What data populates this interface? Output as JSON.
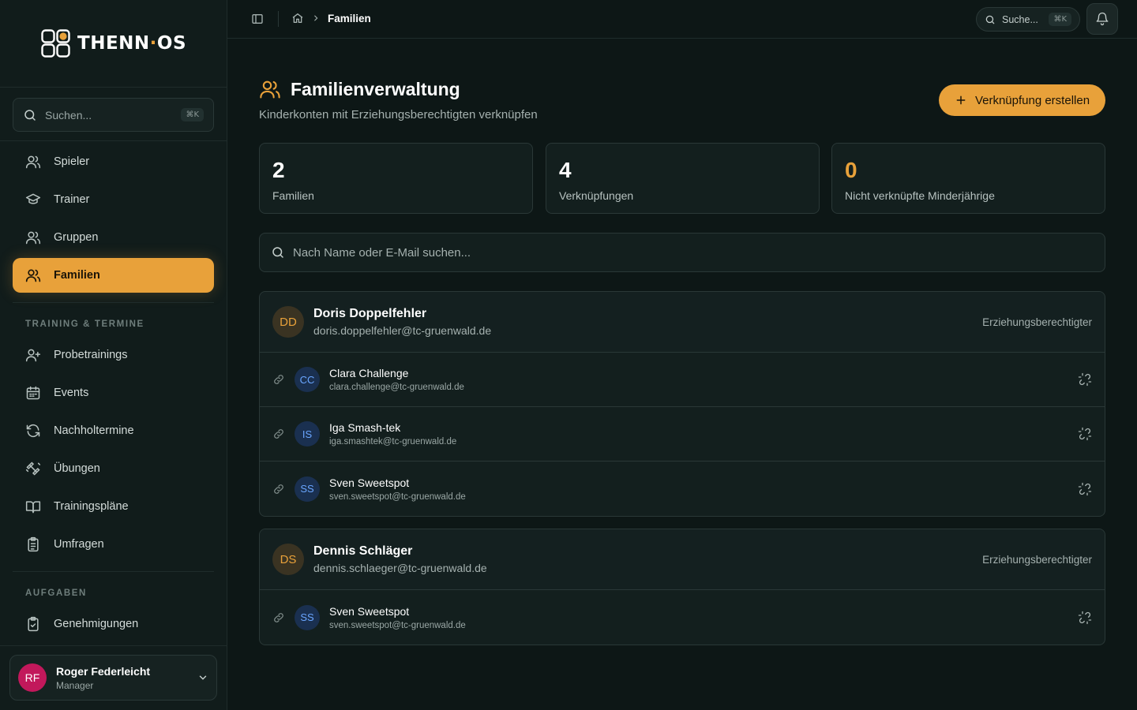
{
  "app": {
    "logo_text_a": "THENN",
    "logo_dot": "·",
    "logo_text_b": "OS"
  },
  "sidebar": {
    "search": {
      "placeholder": "Suchen...",
      "shortcut": "⌘K"
    },
    "main_items": [
      {
        "label": "Spieler",
        "icon": "users-icon"
      },
      {
        "label": "Trainer",
        "icon": "graduation-cap-icon"
      },
      {
        "label": "Gruppen",
        "icon": "users-icon"
      },
      {
        "label": "Familien",
        "icon": "users-icon",
        "active": true
      }
    ],
    "section_training": "TRAINING & TERMINE",
    "training_items": [
      {
        "label": "Probetrainings",
        "icon": "user-plus-icon"
      },
      {
        "label": "Events",
        "icon": "calendar-icon"
      },
      {
        "label": "Nachholtermine",
        "icon": "refresh-icon"
      },
      {
        "label": "Übungen",
        "icon": "dumbbell-icon"
      },
      {
        "label": "Trainingspläne",
        "icon": "book-icon"
      },
      {
        "label": "Umfragen",
        "icon": "clipboard-list-icon"
      }
    ],
    "section_tasks": "AUFGABEN",
    "task_items": [
      {
        "label": "Genehmigungen",
        "icon": "clipboard-check-icon"
      }
    ],
    "user": {
      "initials": "RF",
      "name": "Roger Federleicht",
      "role": "Manager",
      "avatar_color": "#c2185b"
    }
  },
  "topbar": {
    "breadcrumb_current": "Familien",
    "search": {
      "placeholder": "Suche...",
      "shortcut": "⌘K"
    }
  },
  "page": {
    "title": "Familienverwaltung",
    "subtitle": "Kinderkonten mit Erziehungsberechtigten verknüpfen",
    "cta_label": "Verknüpfung erstellen",
    "accent_color": "#e8a13a",
    "stats": [
      {
        "value": "2",
        "label": "Familien"
      },
      {
        "value": "4",
        "label": "Verknüpfungen"
      },
      {
        "value": "0",
        "label": "Nicht verknüpfte Minderjährige",
        "highlight": true
      }
    ],
    "search_placeholder": "Nach Name oder E-Mail suchen...",
    "families": [
      {
        "initials": "DD",
        "name": "Doris Doppelfehler",
        "email": "doris.doppelfehler@tc-gruenwald.de",
        "role": "Erziehungsberechtigter",
        "children": [
          {
            "initials": "CC",
            "name": "Clara Challenge",
            "email": "clara.challenge@tc-gruenwald.de"
          },
          {
            "initials": "IS",
            "name": "Iga Smash-tek",
            "email": "iga.smashtek@tc-gruenwald.de"
          },
          {
            "initials": "SS",
            "name": "Sven Sweetspot",
            "email": "sven.sweetspot@tc-gruenwald.de"
          }
        ]
      },
      {
        "initials": "DS",
        "name": "Dennis Schläger",
        "email": "dennis.schlaeger@tc-gruenwald.de",
        "role": "Erziehungsberechtigter",
        "children": [
          {
            "initials": "SS",
            "name": "Sven Sweetspot",
            "email": "sven.sweetspot@tc-gruenwald.de"
          }
        ]
      }
    ]
  }
}
